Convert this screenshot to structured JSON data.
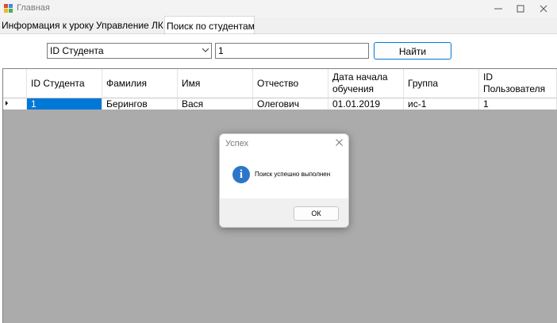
{
  "window": {
    "title": "Главная",
    "icon": "app-icon",
    "controls": [
      "minimize-icon",
      "maximize-icon",
      "close-icon"
    ]
  },
  "tabs": [
    {
      "label": "Информация к уроку",
      "active": false
    },
    {
      "label": "Управление ЛК",
      "active": false
    },
    {
      "label": "Поиск по студентам",
      "active": true
    }
  ],
  "search": {
    "field_selected": "ID Студента",
    "query_value": "1",
    "button_label": "Найти"
  },
  "table": {
    "columns": [
      "ID Студента",
      "Фамилия",
      "Имя",
      "Отчество",
      "Дата начала обучения",
      "Группа",
      "ID Пользователя"
    ],
    "rows": [
      [
        "1",
        "Берингов",
        "Вася",
        "Олегович",
        "01.01.2019",
        "ис-1",
        "1"
      ]
    ]
  },
  "dialog": {
    "title": "Успех",
    "message": "Поиск успешно выполнен",
    "icon": "info-icon",
    "icon_glyph": "i",
    "ok_label": "ОК"
  },
  "colors": {
    "selection": "#0078d7",
    "info_icon": "#2b76c9",
    "grid_background": "#ababab"
  }
}
